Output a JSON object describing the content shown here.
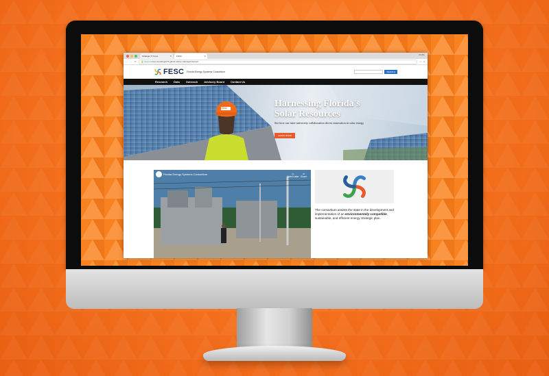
{
  "browser": {
    "tabs": [
      {
        "label": "Strategic IT Cons",
        "active": false
      },
      {
        "label": "FESC",
        "active": true
      }
    ],
    "profile": "Profile",
    "address": {
      "secure_label": "Secure",
      "url": "https://quicknight70.github.io/fesc-redesign/Intersell"
    }
  },
  "site": {
    "logo_text": "FESC",
    "logo_subtitle": "Florida Energy Systems Consortium",
    "search_button": "SEARCH",
    "nav": [
      "Research",
      "Data",
      "Outreach",
      "Advisory Board",
      "Contact Us"
    ],
    "hero": {
      "title_line1": "Harnessing Florida's",
      "title_line2": "Solar Resources",
      "subtitle": "See how our inter-university collaboration drives innovation in solar energy",
      "button": "LEARN MORE",
      "helmet_text": "FESC"
    },
    "video": {
      "title": "Florida Energy Systems Consortium",
      "watch_later": "Watch later",
      "share": "Share"
    },
    "description": {
      "part1": "The consortium assists the state in the development and implementation of an ",
      "bold": "environmentally compatible",
      "part2": ", sustainable, and efficient energy strategic plan."
    }
  },
  "colors": {
    "background": "#f77420",
    "accent": "#e8592c",
    "nav": "#121212",
    "logo_text": "#1e2b4a"
  }
}
